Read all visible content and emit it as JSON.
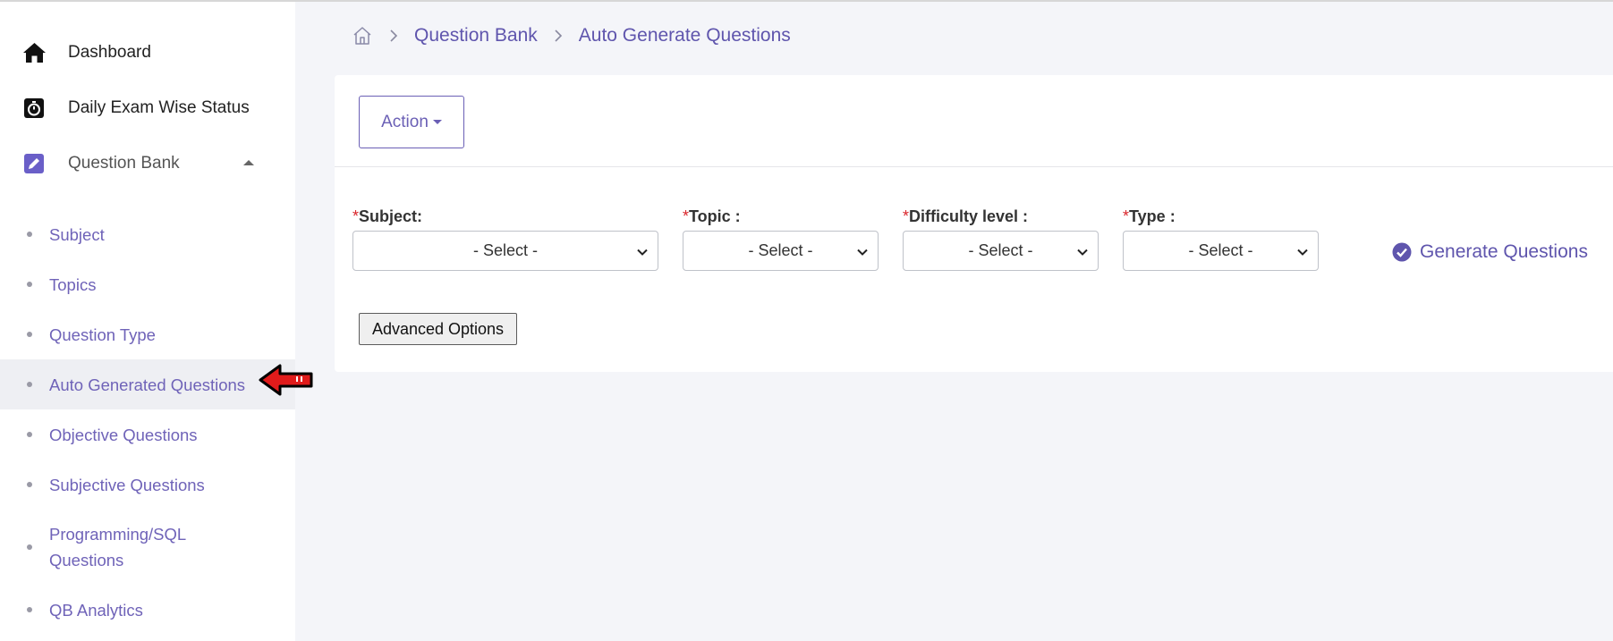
{
  "sidebar": {
    "main_items": [
      {
        "label": "Dashboard",
        "icon": "home-icon"
      },
      {
        "label": "Daily Exam Wise Status",
        "icon": "stopwatch-icon"
      },
      {
        "label": "Question Bank",
        "icon": "edit-icon"
      }
    ],
    "sub_items": [
      {
        "label": "Subject"
      },
      {
        "label": "Topics"
      },
      {
        "label": "Question Type"
      },
      {
        "label": "Auto Generated Questions",
        "active": true
      },
      {
        "label": "Objective Questions"
      },
      {
        "label": "Subjective Questions"
      },
      {
        "label": "Programming/SQL Questions"
      },
      {
        "label": "QB Analytics"
      }
    ]
  },
  "breadcrumb": {
    "items": [
      "Question Bank",
      "Auto Generate Questions"
    ]
  },
  "card": {
    "action_label": "Action",
    "fields": [
      {
        "label": "Subject:",
        "required_mark": "*",
        "value": "- Select -"
      },
      {
        "label": "Topic :",
        "required_mark": "*",
        "value": "- Select -"
      },
      {
        "label": "Difficulty level :",
        "required_mark": "*",
        "value": "- Select -"
      },
      {
        "label": "Type :",
        "required_mark": "*",
        "value": "- Select -"
      }
    ],
    "generate_label": "Generate Questions",
    "advanced_label": "Advanced Options"
  },
  "colors": {
    "accent": "#6a5fb5",
    "required": "#d9262c",
    "pointer_arrow": "#e11b1b"
  }
}
